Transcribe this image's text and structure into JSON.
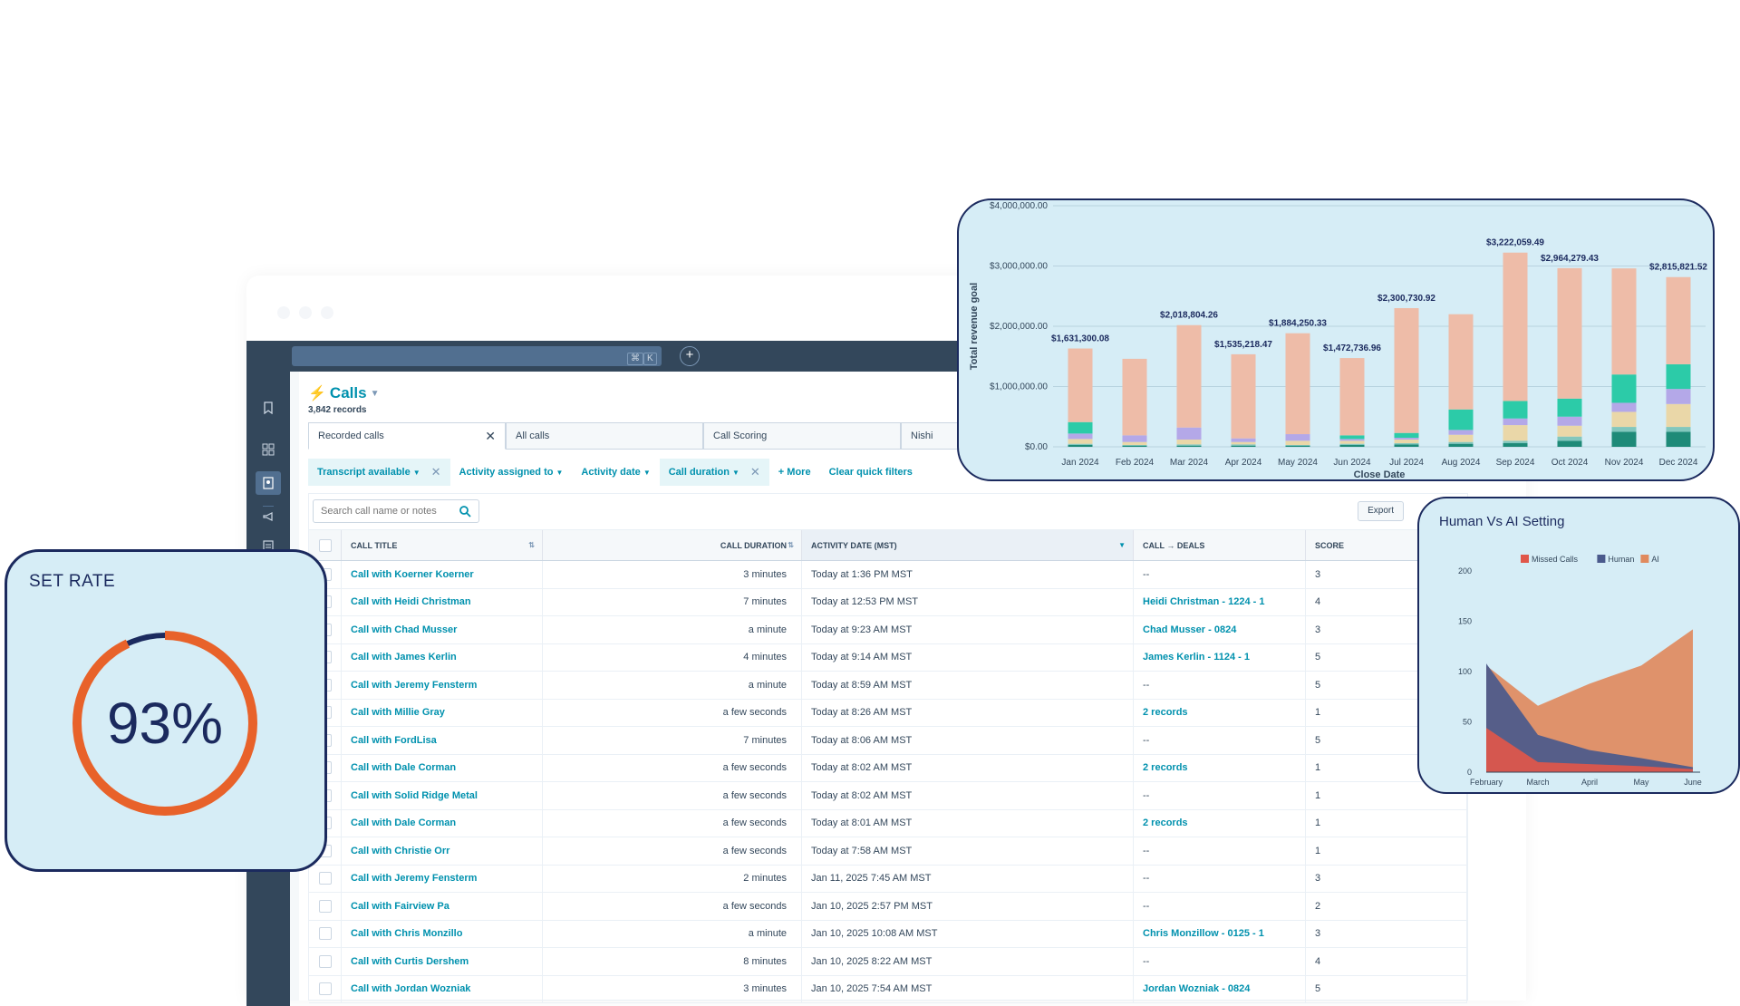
{
  "app": {
    "kbd_keys": [
      "⌘",
      "K"
    ],
    "plus_label": "+"
  },
  "page": {
    "title": "Calls",
    "records": "3,842 records"
  },
  "views": [
    {
      "label": "Recorded calls",
      "active": true
    },
    {
      "label": "All calls",
      "active": false
    },
    {
      "label": "Call Scoring",
      "active": false
    },
    {
      "label": "Nishi",
      "active": false
    }
  ],
  "filters": [
    {
      "label": "Transcript available",
      "active": true,
      "dropdown": true,
      "removable": true
    },
    {
      "label": "Activity assigned to",
      "active": false,
      "dropdown": true,
      "removable": false
    },
    {
      "label": "Activity date",
      "active": false,
      "dropdown": true,
      "removable": false
    },
    {
      "label": "Call duration",
      "active": true,
      "dropdown": true,
      "removable": true
    },
    {
      "label": "+ More",
      "active": false,
      "dropdown": false,
      "removable": false
    },
    {
      "label": "Clear quick filters",
      "active": false,
      "dropdown": false,
      "removable": false
    }
  ],
  "search": {
    "placeholder": "Search call name or notes",
    "value": ""
  },
  "export_label": "Export",
  "table": {
    "columns": [
      "Call title",
      "Call duration",
      "Activity date (MST)",
      "Call → Deals",
      "Score"
    ],
    "rows": [
      {
        "title": "Call with Koerner Koerner",
        "duration": "3 minutes",
        "date": "Today at 1:36 PM MST",
        "deal": "--",
        "score": "3"
      },
      {
        "title": "Call with Heidi Christman",
        "duration": "7 minutes",
        "date": "Today at 12:53 PM MST",
        "deal": "Heidi Christman - 1224 - 1",
        "score": "4"
      },
      {
        "title": "Call with Chad Musser",
        "duration": "a minute",
        "date": "Today at 9:23 AM MST",
        "deal": "Chad Musser - 0824",
        "score": "3"
      },
      {
        "title": "Call with James Kerlin",
        "duration": "4 minutes",
        "date": "Today at 9:14 AM MST",
        "deal": "James Kerlin - 1124 - 1",
        "score": "5"
      },
      {
        "title": "Call with Jeremy Fensterm",
        "duration": "a minute",
        "date": "Today at 8:59 AM MST",
        "deal": "--",
        "score": "5"
      },
      {
        "title": "Call with Millie Gray",
        "duration": "a few seconds",
        "date": "Today at 8:26 AM MST",
        "deal": "2 records",
        "score": "1"
      },
      {
        "title": "Call with FordLisa",
        "duration": "7 minutes",
        "date": "Today at 8:06 AM MST",
        "deal": "--",
        "score": "5"
      },
      {
        "title": "Call with Dale Corman",
        "duration": "a few seconds",
        "date": "Today at 8:02 AM MST",
        "deal": "2 records",
        "score": "1"
      },
      {
        "title": "Call with Solid Ridge Metal",
        "duration": "a few seconds",
        "date": "Today at 8:02 AM MST",
        "deal": "--",
        "score": "1"
      },
      {
        "title": "Call with Dale Corman",
        "duration": "a few seconds",
        "date": "Today at 8:01 AM MST",
        "deal": "2 records",
        "score": "1"
      },
      {
        "title": "Call with Christie Orr",
        "duration": "a few seconds",
        "date": "Today at 7:58 AM MST",
        "deal": "--",
        "score": "1"
      },
      {
        "title": "Call with Jeremy Fensterm",
        "duration": "2 minutes",
        "date": "Jan 11, 2025 7:45 AM MST",
        "deal": "--",
        "score": "3"
      },
      {
        "title": "Call with Fairview Pa",
        "duration": "a few seconds",
        "date": "Jan 10, 2025 2:57 PM MST",
        "deal": "--",
        "score": "2"
      },
      {
        "title": "Call with Chris Monzillo",
        "duration": "a minute",
        "date": "Jan 10, 2025 10:08 AM MST",
        "deal": "Chris Monzillow - 0125 - 1",
        "score": "3"
      },
      {
        "title": "Call with Curtis Dershem",
        "duration": "8 minutes",
        "date": "Jan 10, 2025 8:22 AM MST",
        "deal": "--",
        "score": "4"
      },
      {
        "title": "Call with Jordan Wozniak",
        "duration": "3 minutes",
        "date": "Jan 10, 2025 7:54 AM MST",
        "deal": "Jordan Wozniak - 0824",
        "score": "5"
      }
    ]
  },
  "set_rate": {
    "title": "SET RATE",
    "value": "93%",
    "percent": 93,
    "ring_color": "#e8622a",
    "track_color": "#1b2a5e"
  },
  "colors": {
    "accent": "#0091ae",
    "nav": "#33475b",
    "card_bg": "#d6edf6",
    "card_border": "#1b2a5e"
  },
  "chart_data": [
    {
      "type": "bar",
      "stacked": true,
      "title": "",
      "xlabel": "Close Date",
      "ylabel": "Total revenue goal",
      "ylim": [
        0,
        4000000
      ],
      "yticks": [
        "$0.00",
        "$1,000,000.00",
        "$2,000,000.00",
        "$3,000,000.00",
        "$4,000,000.00"
      ],
      "grid": true,
      "categories": [
        "Jan 2024",
        "Feb 2024",
        "Mar 2024",
        "Apr 2024",
        "May 2024",
        "Jun 2024",
        "Jul 2024",
        "Aug 2024",
        "Sep 2024",
        "Oct 2024",
        "Nov 2024",
        "Dec 2024"
      ],
      "totals": [
        1631300.08,
        1460000,
        2018804.26,
        1535218.47,
        1884250.33,
        1472736.96,
        2300730.92,
        2200000,
        3222059.49,
        2964279.43,
        2960000,
        2815821.52
      ],
      "total_labels": [
        "$1,631,300.08",
        "",
        "$2,018,804.26",
        "$1,535,218.47",
        "$1,884,250.33",
        "$1,472,736.96",
        "$2,300,730.92",
        "",
        "$3,222,059.49",
        "$2,964,279.43",
        "",
        "$2,815,821.52"
      ],
      "series": [
        {
          "color": "#1e8a78",
          "values": [
            30000,
            20000,
            20000,
            20000,
            20000,
            30000,
            40000,
            50000,
            60000,
            100000,
            250000,
            250000
          ]
        },
        {
          "color": "#82c7bd",
          "values": [
            20000,
            10000,
            20000,
            20000,
            10000,
            20000,
            20000,
            30000,
            40000,
            70000,
            80000,
            80000
          ]
        },
        {
          "color": "#ead7a8",
          "values": [
            80000,
            50000,
            80000,
            40000,
            70000,
            50000,
            60000,
            120000,
            260000,
            180000,
            250000,
            380000
          ]
        },
        {
          "color": "#b4a8e8",
          "values": [
            90000,
            110000,
            200000,
            60000,
            110000,
            30000,
            30000,
            80000,
            110000,
            150000,
            150000,
            250000
          ]
        },
        {
          "color": "#2ccba8",
          "values": [
            190000,
            0,
            0,
            0,
            0,
            60000,
            80000,
            340000,
            290000,
            300000,
            470000,
            410000
          ]
        },
        {
          "color": "#eebca8",
          "values": [
            1221300.08,
            1270000,
            1698804.26,
            1395218.47,
            1674250.33,
            1282736.96,
            2070730.92,
            1580000,
            2462059.49,
            2164279.43,
            1760000,
            1445821.52
          ]
        }
      ]
    },
    {
      "type": "area",
      "title": "Human Vs AI Setting",
      "x": [
        "February",
        "March",
        "April",
        "May",
        "June"
      ],
      "ylim": [
        0,
        200
      ],
      "yticks": [
        0,
        50,
        100,
        150,
        200
      ],
      "legend_position": "top",
      "series": [
        {
          "name": "AI",
          "color": "#e08a5e",
          "values": [
            106,
            66,
            88,
            106,
            142
          ]
        },
        {
          "name": "Human",
          "color": "#4a5a8c",
          "values": [
            108,
            37,
            22,
            14,
            5
          ]
        },
        {
          "name": "Missed Calls",
          "color": "#e0574a",
          "values": [
            44,
            10,
            8,
            6,
            3
          ]
        }
      ],
      "legend": [
        "Missed Calls",
        "Human",
        "AI"
      ]
    }
  ]
}
